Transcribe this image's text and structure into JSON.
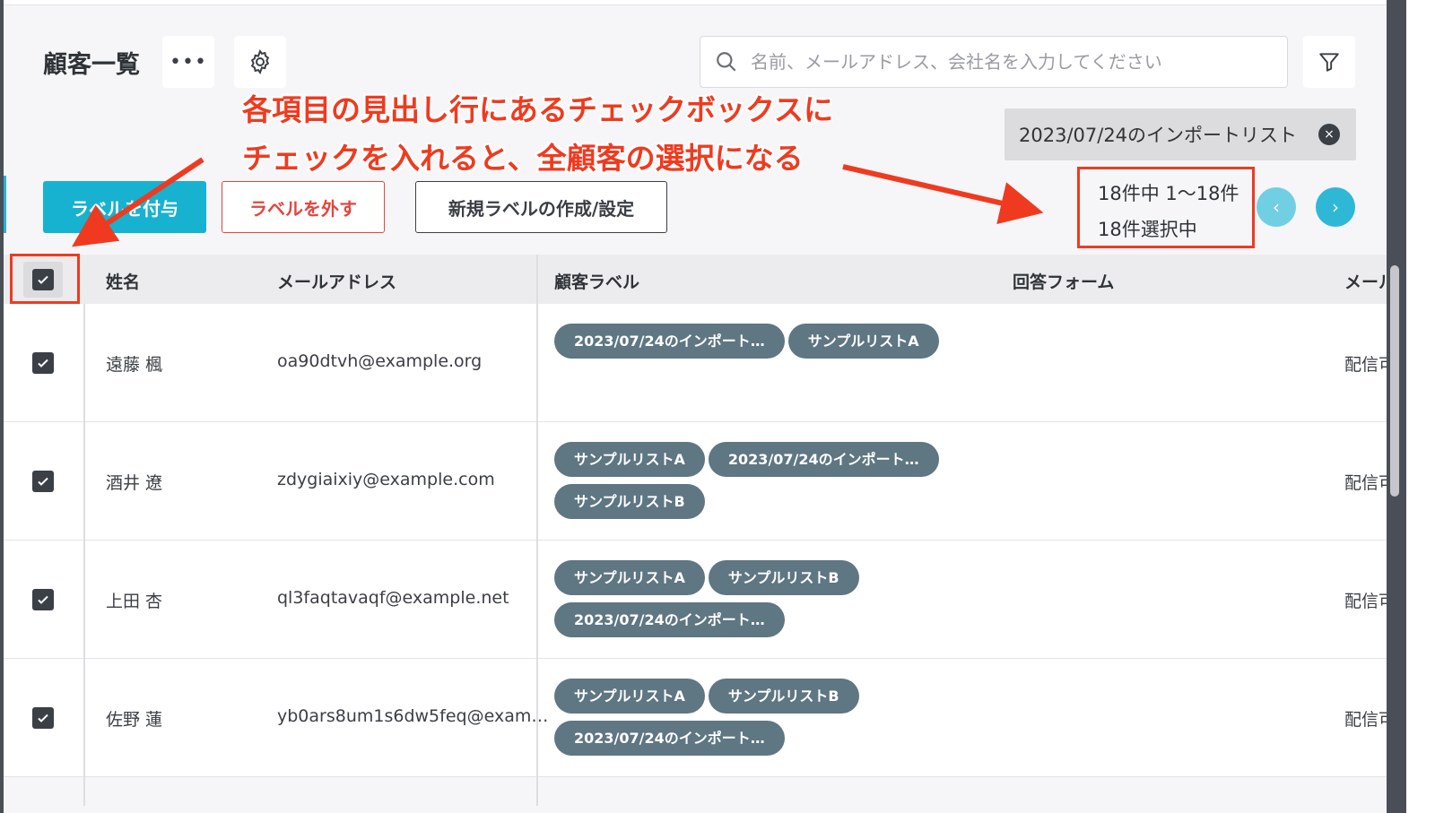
{
  "header": {
    "title": "顧客一覧",
    "more_label": "•••",
    "search_placeholder": "名前、メールアドレス、会社名を入力してください"
  },
  "filter_chip": {
    "label": "2023/07/24のインポートリスト",
    "close_label": "×"
  },
  "actions": {
    "assign_label": "ラベルを付与",
    "remove_label": "ラベルを外す",
    "create_label": "新規ラベルの作成/設定"
  },
  "pagination": {
    "range_text": "18件中 1〜18件",
    "selected_text": "18件選択中",
    "prev_label": "‹",
    "next_label": "›"
  },
  "table": {
    "columns": [
      "姓名",
      "メールアドレス",
      "顧客ラベル",
      "回答フォーム",
      "メール"
    ],
    "rows": [
      {
        "name": "遠藤 楓",
        "email": "oa90dtvh@example.org",
        "labels": [
          "2023/07/24のインポート…",
          "サンプルリストA"
        ],
        "mail": "配信可"
      },
      {
        "name": "酒井 遼",
        "email": "zdygiaixiy@example.com",
        "labels": [
          "サンプルリストA",
          "2023/07/24のインポート…",
          "サンプルリストB"
        ],
        "mail": "配信可"
      },
      {
        "name": "上田 杏",
        "email": "ql3faqtavaqf@example.net",
        "labels": [
          "サンプルリストA",
          "サンプルリストB",
          "2023/07/24のインポート…"
        ],
        "mail": "配信可"
      },
      {
        "name": "佐野 蓮",
        "email": "yb0ars8um1s6dw5feq@exam…",
        "labels": [
          "サンプルリストA",
          "サンプルリストB",
          "2023/07/24のインポート…"
        ],
        "mail": "配信可"
      }
    ]
  },
  "annotation": {
    "line1": "各項目の見出し行にあるチェックボックスに",
    "line2": "チェックを入れると、全顧客の選択になる",
    "color": "#f03a1f"
  },
  "colors": {
    "accent": "#17b2cf",
    "danger": "#e1463f",
    "tag": "#5f7683"
  }
}
